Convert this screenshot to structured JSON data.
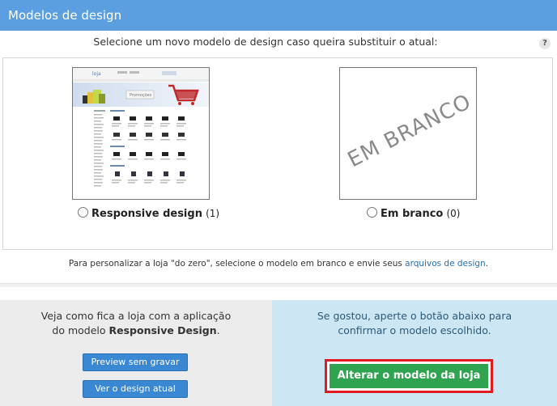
{
  "header": {
    "title": "Modelos de design"
  },
  "subtitle": "Selecione um novo modelo de design caso queira substituir o atual:",
  "help_icon": "?",
  "templates": [
    {
      "name": "Responsive design",
      "count": "(1)",
      "thumbnail": "store-preview"
    },
    {
      "name": "Em branco",
      "count": "(0)",
      "thumbnail_text": "EM BRANCO"
    }
  ],
  "store_preview": {
    "logo_text": "loja",
    "banner_text": "Promoções"
  },
  "note": {
    "prefix": "Para personalizar a loja \"do zero\", selecione o modelo em branco e envie seus ",
    "link": "arquivos de design",
    "suffix": "."
  },
  "left_panel": {
    "line1": "Veja como fica a loja com a aplicação",
    "line2_prefix": "do modelo ",
    "line2_bold": "Responsive Design",
    "line2_suffix": ".",
    "preview_button": "Preview sem gravar",
    "current_button": "Ver o design atual"
  },
  "right_panel": {
    "line1": "Se gostou, aperte o botão abaixo para",
    "line2": "confirmar o modelo escolhido.",
    "confirm_button": "Alterar o modelo da loja"
  },
  "colors": {
    "header_bg": "#5b9fe0",
    "primary_button": "#3a88d4",
    "confirm_button": "#2fa34f",
    "highlight_border": "#e01b24",
    "right_panel_bg": "#cde6f3"
  }
}
